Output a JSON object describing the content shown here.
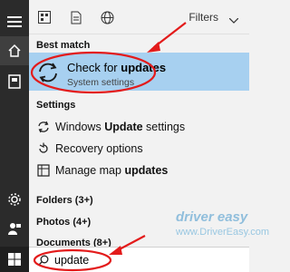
{
  "colors": {
    "accent": "#0078d7",
    "highlight": "#a7d0f0",
    "annotation": "#e31b1b"
  },
  "topbar": {
    "filters_label": "Filters",
    "icons": [
      "apps-icon",
      "document-icon",
      "globe-icon",
      "chevron-down-icon"
    ]
  },
  "best_match": {
    "header": "Best match",
    "title_prefix": "Check for ",
    "title_bold": "updates",
    "subtitle": "System settings"
  },
  "settings": {
    "header": "Settings",
    "items": [
      {
        "prefix": "Windows ",
        "bold": "Update",
        "suffix": " settings",
        "icon": "refresh-icon"
      },
      {
        "prefix": "Recovery options",
        "bold": "",
        "suffix": "",
        "icon": "recovery-icon"
      },
      {
        "prefix": "Manage map ",
        "bold": "updates",
        "suffix": "",
        "icon": "map-icon"
      }
    ]
  },
  "groups": [
    {
      "label": "Folders (3+)"
    },
    {
      "label": "Photos (4+)"
    },
    {
      "label": "Documents (8+)"
    }
  ],
  "search": {
    "value": "update"
  },
  "watermark": {
    "brand": "driver easy",
    "url": "www.DriverEasy.com"
  }
}
